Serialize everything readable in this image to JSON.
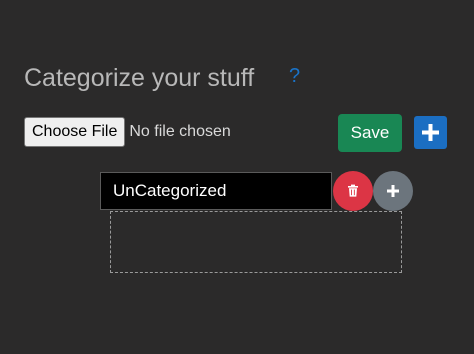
{
  "header": {
    "title": "Categorize your stuff",
    "help_label": "?"
  },
  "file_input": {
    "button_label": "Choose File",
    "status_text": "No file chosen"
  },
  "toolbar": {
    "save_label": "Save",
    "add_category_icon": "plus-icon"
  },
  "category": {
    "name": "UnCategorized",
    "delete_icon": "trash-icon",
    "add_sub_icon": "plus-icon"
  },
  "colors": {
    "background": "#2b2a2a",
    "title_text": "#b8b8b8",
    "help_link": "#1a73c8",
    "save_button": "#198754",
    "add_button": "#1b6ec2",
    "delete_button": "#dc3545",
    "add_sub_button": "#6c757d",
    "input_background": "#000000"
  }
}
